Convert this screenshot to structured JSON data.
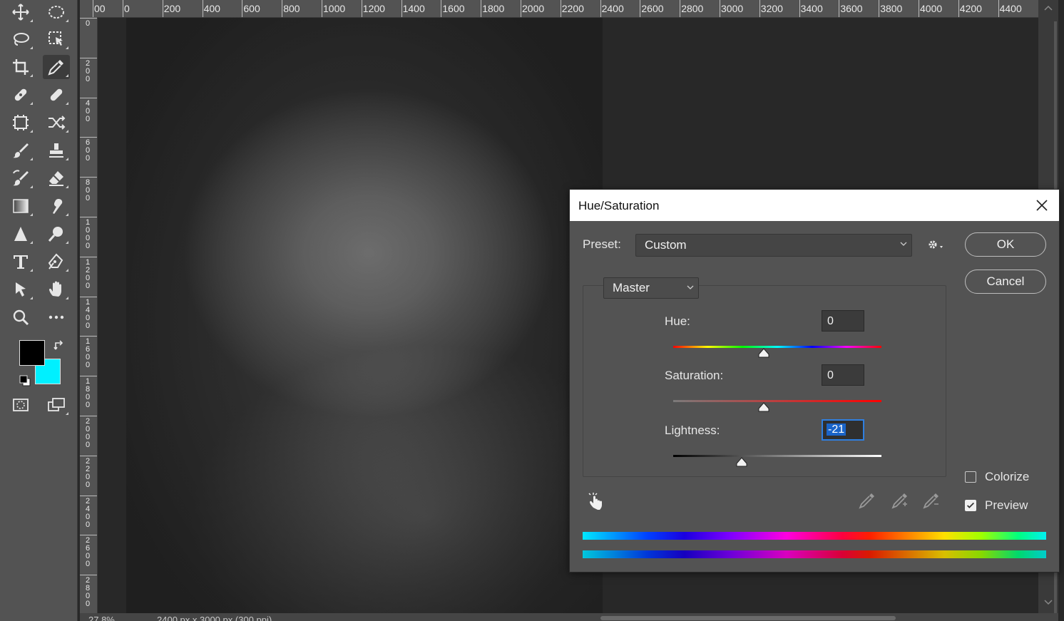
{
  "ruler": {
    "top_labels": [
      "00",
      "0",
      "200",
      "400",
      "600",
      "800",
      "1000",
      "1200",
      "1400",
      "1600",
      "1800",
      "2000",
      "2200",
      "2400",
      "2600",
      "2800",
      "3000",
      "3200",
      "3400",
      "3600",
      "3800",
      "4000",
      "4200",
      "4400"
    ],
    "left_labels": [
      "0",
      "200",
      "400",
      "600",
      "800",
      "1000",
      "1200",
      "1400",
      "1600",
      "1800",
      "2000",
      "2200",
      "2400",
      "2600",
      "2800"
    ]
  },
  "colors": {
    "foreground": "#000000",
    "background": "#00f0ff",
    "accent": "#2f7fe0"
  },
  "status": {
    "zoom": "27.8%",
    "doc_info": "2400 px x 3000 px (300 ppi)"
  },
  "dialog": {
    "title": "Hue/Saturation",
    "preset_label": "Preset:",
    "preset_value": "Custom",
    "ok_label": "OK",
    "cancel_label": "Cancel",
    "channel_value": "Master",
    "hue_label": "Hue:",
    "hue_value": "0",
    "saturation_label": "Saturation:",
    "saturation_value": "0",
    "lightness_label": "Lightness:",
    "lightness_value": "-21",
    "colorize_label": "Colorize",
    "colorize_checked": false,
    "preview_label": "Preview",
    "preview_checked": true
  },
  "icons": [
    "move-icon",
    "marquee-icon",
    "lasso-icon",
    "object-select-icon",
    "crop-icon",
    "eyedropper-icon",
    "spot-heal-icon",
    "bandage-icon",
    "frame-icon",
    "shuffle-icon",
    "brush-icon",
    "stamp-icon",
    "history-brush-icon",
    "eraser-icon",
    "gradient-icon",
    "smudge-icon",
    "triangle-shape-icon",
    "dodge-icon",
    "type-icon",
    "pen-icon",
    "path-select-icon",
    "hand-icon",
    "zoom-icon",
    "more-icon",
    "quick-mask-icon",
    "screen-mode-icon"
  ]
}
